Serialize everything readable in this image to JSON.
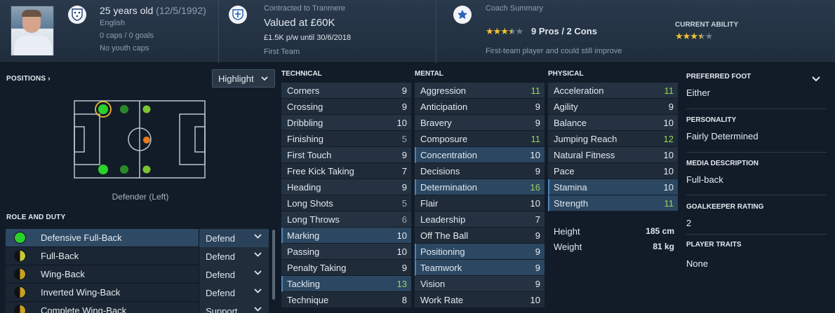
{
  "header": {
    "age": "25 years old",
    "dob": "(12/5/1992)",
    "nationality": "English",
    "caps": "0 caps / 0 goals",
    "youth_caps": "No youth caps",
    "contract_label": "Contracted to Tranmere",
    "value": "Valued at £60K",
    "wage": "£1.5K p/w until 30/6/2018",
    "squad_status": "First Team",
    "coach_title": "Coach Summary",
    "pros_cons": "9 Pros / 2 Cons",
    "coach_summary_text": "First-team player and could still improve",
    "current_ability_label": "CURRENT ABILITY",
    "current_ability_stars": 3.5,
    "coach_stars": 3.5
  },
  "positions": {
    "label": "POSITIONS",
    "highlight_label": "Highlight",
    "current_position": "Defender (Left)"
  },
  "role_duty": {
    "label": "ROLE AND DUTY",
    "roles": [
      {
        "name": "Defensive Full-Back",
        "duty": "Defend",
        "rating": "natural",
        "selected": true
      },
      {
        "name": "Full-Back",
        "duty": "Defend",
        "rating": "half",
        "selected": false
      },
      {
        "name": "Wing-Back",
        "duty": "Defend",
        "rating": "half-gold",
        "selected": false
      },
      {
        "name": "Inverted Wing-Back",
        "duty": "Defend",
        "rating": "half-gold",
        "selected": false
      },
      {
        "name": "Complete Wing-Back",
        "duty": "Support",
        "rating": "half-gold",
        "selected": false
      }
    ]
  },
  "technical": {
    "label": "TECHNICAL",
    "attributes": [
      {
        "name": "Corners",
        "value": "9",
        "hl": false
      },
      {
        "name": "Crossing",
        "value": "9",
        "hl": false
      },
      {
        "name": "Dribbling",
        "value": "10",
        "hl": false
      },
      {
        "name": "Finishing",
        "value": "5",
        "hl": false
      },
      {
        "name": "First Touch",
        "value": "9",
        "hl": false
      },
      {
        "name": "Free Kick Taking",
        "value": "7",
        "hl": false
      },
      {
        "name": "Heading",
        "value": "9",
        "hl": false
      },
      {
        "name": "Long Shots",
        "value": "5",
        "hl": false
      },
      {
        "name": "Long Throws",
        "value": "6",
        "hl": false
      },
      {
        "name": "Marking",
        "value": "10",
        "hl": true
      },
      {
        "name": "Passing",
        "value": "10",
        "hl": false
      },
      {
        "name": "Penalty Taking",
        "value": "9",
        "hl": false
      },
      {
        "name": "Tackling",
        "value": "13",
        "hl": true
      },
      {
        "name": "Technique",
        "value": "8",
        "hl": false
      }
    ]
  },
  "mental": {
    "label": "MENTAL",
    "attributes": [
      {
        "name": "Aggression",
        "value": "11",
        "hl": false
      },
      {
        "name": "Anticipation",
        "value": "9",
        "hl": false
      },
      {
        "name": "Bravery",
        "value": "9",
        "hl": false
      },
      {
        "name": "Composure",
        "value": "11",
        "hl": false
      },
      {
        "name": "Concentration",
        "value": "10",
        "hl": true
      },
      {
        "name": "Decisions",
        "value": "9",
        "hl": false
      },
      {
        "name": "Determination",
        "value": "16",
        "hl": true
      },
      {
        "name": "Flair",
        "value": "10",
        "hl": false
      },
      {
        "name": "Leadership",
        "value": "7",
        "hl": false
      },
      {
        "name": "Off The Ball",
        "value": "9",
        "hl": false
      },
      {
        "name": "Positioning",
        "value": "9",
        "hl": true
      },
      {
        "name": "Teamwork",
        "value": "9",
        "hl": true
      },
      {
        "name": "Vision",
        "value": "9",
        "hl": false
      },
      {
        "name": "Work Rate",
        "value": "10",
        "hl": false
      }
    ]
  },
  "physical": {
    "label": "PHYSICAL",
    "attributes": [
      {
        "name": "Acceleration",
        "value": "11",
        "hl": false
      },
      {
        "name": "Agility",
        "value": "9",
        "hl": false
      },
      {
        "name": "Balance",
        "value": "10",
        "hl": false
      },
      {
        "name": "Jumping Reach",
        "value": "12",
        "hl": false
      },
      {
        "name": "Natural Fitness",
        "value": "10",
        "hl": false
      },
      {
        "name": "Pace",
        "value": "10",
        "hl": false
      },
      {
        "name": "Stamina",
        "value": "10",
        "hl": true
      },
      {
        "name": "Strength",
        "value": "11",
        "hl": true
      }
    ],
    "height_label": "Height",
    "height": "185 cm",
    "weight_label": "Weight",
    "weight": "81 kg"
  },
  "info": {
    "preferred_foot_label": "PREFERRED FOOT",
    "preferred_foot": "Either",
    "personality_label": "PERSONALITY",
    "personality": "Fairly Determined",
    "media_label": "MEDIA DESCRIPTION",
    "media": "Full-back",
    "gk_label": "GOALKEEPER RATING",
    "gk": "2",
    "traits_label": "PLAYER TRAITS",
    "traits": "None"
  },
  "colors": {
    "high_value": "#9bd45c",
    "low_value": "#97a6b6",
    "star": "#f2c230",
    "natural_role": "#2bd12b",
    "accomplished_role": "#c8c834"
  }
}
